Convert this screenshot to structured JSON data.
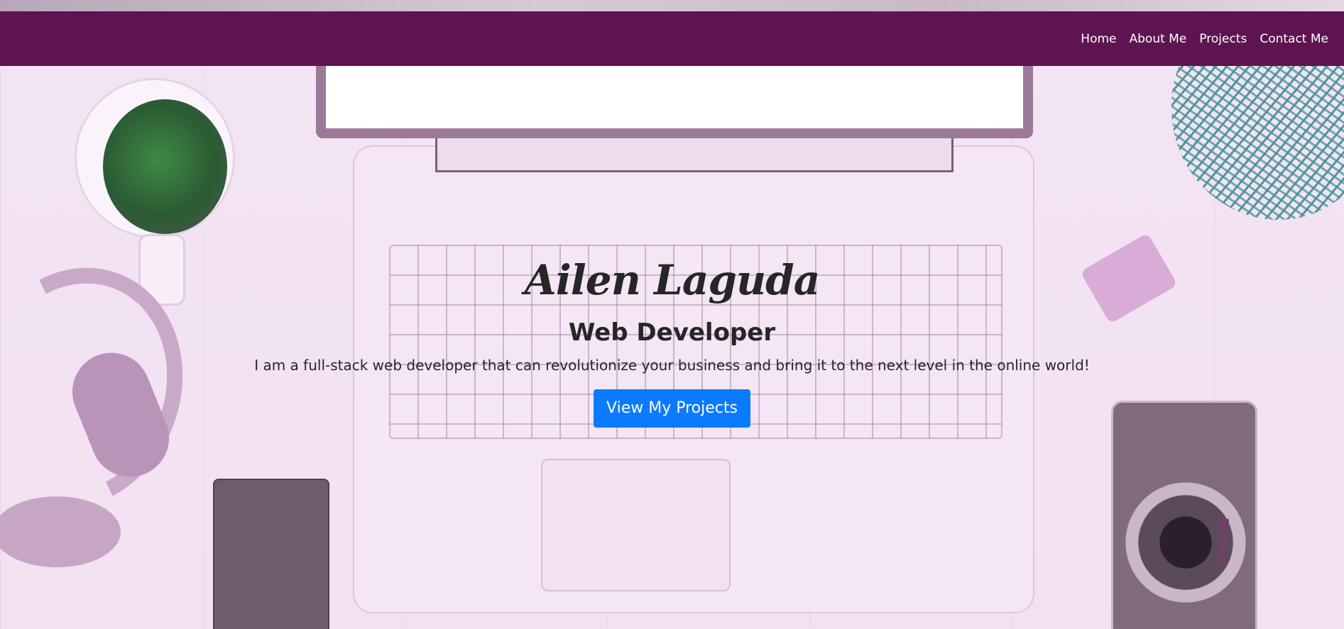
{
  "nav": {
    "items": [
      {
        "label": "Home"
      },
      {
        "label": "About Me"
      },
      {
        "label": "Projects"
      },
      {
        "label": "Contact Me"
      }
    ]
  },
  "hero": {
    "name": "Ailen Laguda",
    "role": "Web Developer",
    "description": "I am a full-stack web developer that can revolutionize your business and bring it to the next level in the online world!",
    "cta_label": "View My Projects"
  },
  "background": {
    "camera_brand": "Nikon"
  },
  "colors": {
    "navbar": "#5e1450",
    "button": "#0a7bff",
    "text": "#262626",
    "overlay": "#f1e2f0"
  }
}
